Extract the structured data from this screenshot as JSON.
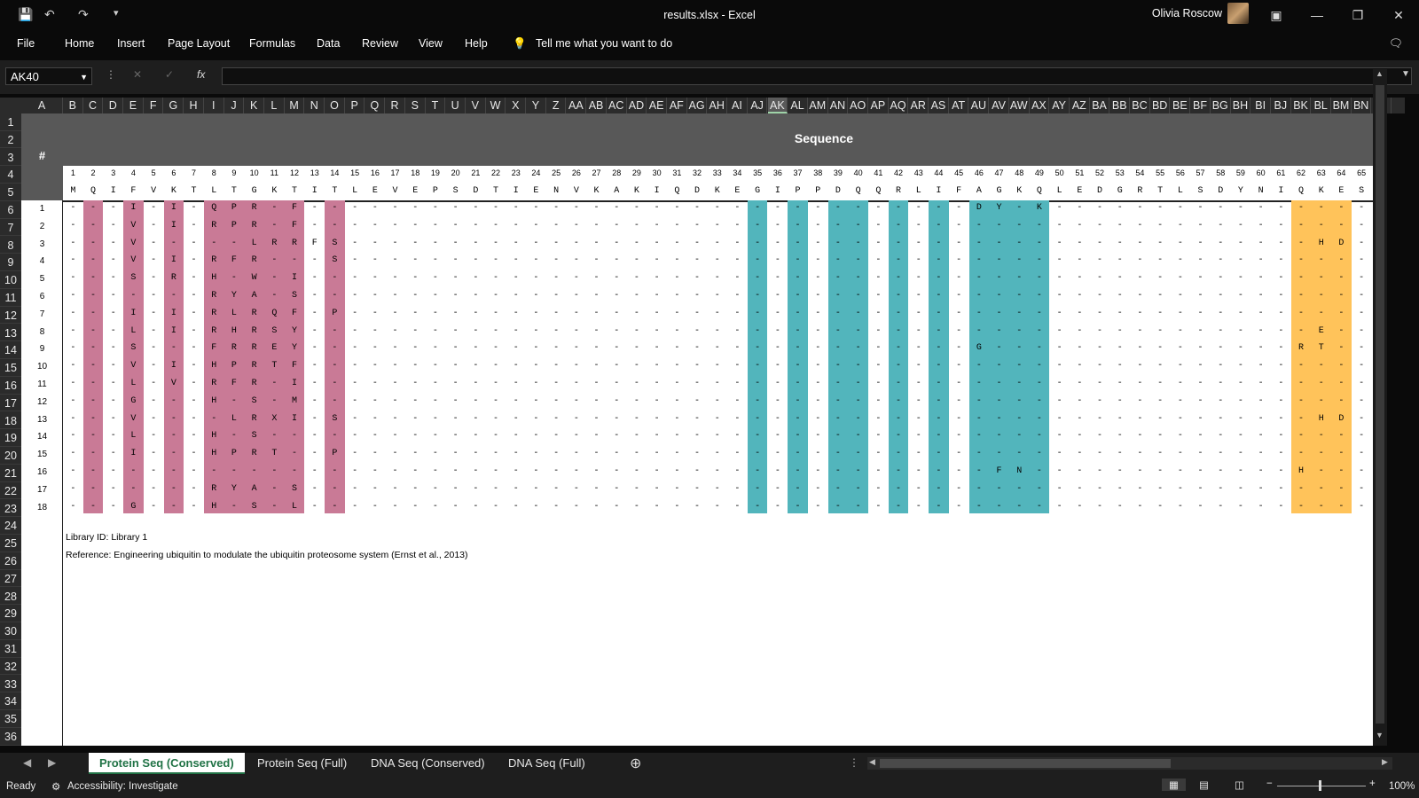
{
  "window": {
    "title": "results.xlsx  -  Excel",
    "user": "Olivia Roscow"
  },
  "ribbon": {
    "tabs": [
      "File",
      "Home",
      "Insert",
      "Page Layout",
      "Formulas",
      "Data",
      "Review",
      "View",
      "Help"
    ],
    "tell_me": "Tell me what you want to do"
  },
  "formula_bar": {
    "name_box": "AK40",
    "fx": "fx",
    "value": ""
  },
  "columns": [
    "A",
    "B",
    "C",
    "D",
    "E",
    "F",
    "G",
    "H",
    "I",
    "J",
    "K",
    "L",
    "M",
    "N",
    "O",
    "P",
    "Q",
    "R",
    "S",
    "T",
    "U",
    "V",
    "W",
    "X",
    "Y",
    "Z",
    "AA",
    "AB",
    "AC",
    "AD",
    "AE",
    "AF",
    "AG",
    "AH",
    "AI",
    "AJ",
    "AK",
    "AL",
    "AM",
    "AN",
    "AO",
    "AP",
    "AQ",
    "AR",
    "AS",
    "AT",
    "AU",
    "AV",
    "AW",
    "AX",
    "AY",
    "AZ",
    "BA",
    "BB",
    "BC",
    "BD",
    "BE",
    "BF",
    "BG",
    "BH",
    "BI",
    "BJ",
    "BK",
    "BL",
    "BM",
    "BN",
    "B"
  ],
  "selected_column": "AK",
  "rows": [
    "1",
    "2",
    "3",
    "4",
    "5",
    "6",
    "7",
    "8",
    "9",
    "10",
    "11",
    "12",
    "13",
    "14",
    "15",
    "16",
    "17",
    "18",
    "19",
    "20",
    "21",
    "22",
    "23",
    "24",
    "25",
    "26",
    "27",
    "28",
    "29",
    "30",
    "31",
    "32",
    "33",
    "34",
    "35",
    "36"
  ],
  "sheet": {
    "hash": "#",
    "header": "Sequence",
    "positions": [
      "1",
      "2",
      "3",
      "4",
      "5",
      "6",
      "7",
      "8",
      "9",
      "10",
      "11",
      "12",
      "13",
      "14",
      "15",
      "16",
      "17",
      "18",
      "19",
      "20",
      "21",
      "22",
      "23",
      "24",
      "25",
      "26",
      "27",
      "28",
      "29",
      "30",
      "31",
      "32",
      "33",
      "34",
      "35",
      "36",
      "37",
      "38",
      "39",
      "40",
      "41",
      "42",
      "43",
      "44",
      "45",
      "46",
      "47",
      "48",
      "49",
      "50",
      "51",
      "52",
      "53",
      "54",
      "55",
      "56",
      "57",
      "58",
      "59",
      "60",
      "61",
      "62",
      "63",
      "64",
      "65"
    ],
    "reference_seq": [
      "M",
      "Q",
      "I",
      "F",
      "V",
      "K",
      "T",
      "L",
      "T",
      "G",
      "K",
      "T",
      "I",
      "T",
      "L",
      "E",
      "V",
      "E",
      "P",
      "S",
      "D",
      "T",
      "I",
      "E",
      "N",
      "V",
      "K",
      "A",
      "K",
      "I",
      "Q",
      "D",
      "K",
      "E",
      "G",
      "I",
      "P",
      "P",
      "D",
      "Q",
      "Q",
      "R",
      "L",
      "I",
      "F",
      "A",
      "G",
      "K",
      "Q",
      "L",
      "E",
      "D",
      "G",
      "R",
      "T",
      "L",
      "S",
      "D",
      "Y",
      "N",
      "I",
      "Q",
      "K",
      "E",
      "S"
    ],
    "variants": [
      {
        "id": "1",
        "changes": {
          "4": "I",
          "6": "I",
          "8": "Q",
          "9": "P",
          "10": "R",
          "12": "F",
          "46": "D",
          "47": "Y",
          "49": "K"
        }
      },
      {
        "id": "2",
        "changes": {
          "4": "V",
          "6": "I",
          "8": "R",
          "9": "P",
          "10": "R",
          "12": "F"
        }
      },
      {
        "id": "3",
        "changes": {
          "4": "V",
          "10": "L",
          "11": "R",
          "12": "R",
          "13": "F",
          "14": "S",
          "63": "H",
          "64": "D"
        }
      },
      {
        "id": "4",
        "changes": {
          "4": "V",
          "6": "I",
          "8": "R",
          "9": "F",
          "10": "R",
          "14": "S"
        }
      },
      {
        "id": "5",
        "changes": {
          "4": "S",
          "6": "R",
          "8": "H",
          "10": "W",
          "12": "I"
        }
      },
      {
        "id": "6",
        "changes": {
          "8": "R",
          "9": "Y",
          "10": "A",
          "12": "S"
        }
      },
      {
        "id": "7",
        "changes": {
          "4": "I",
          "6": "I",
          "8": "R",
          "9": "L",
          "10": "R",
          "11": "Q",
          "12": "F",
          "14": "P"
        }
      },
      {
        "id": "8",
        "changes": {
          "4": "L",
          "6": "I",
          "8": "R",
          "9": "H",
          "10": "R",
          "11": "S",
          "12": "Y",
          "63": "E"
        }
      },
      {
        "id": "9",
        "changes": {
          "4": "S",
          "8": "F",
          "9": "R",
          "10": "R",
          "11": "E",
          "12": "Y",
          "46": "G",
          "62": "R",
          "63": "T"
        }
      },
      {
        "id": "10",
        "changes": {
          "4": "V",
          "6": "I",
          "8": "H",
          "9": "P",
          "10": "R",
          "11": "T",
          "12": "F"
        }
      },
      {
        "id": "11",
        "changes": {
          "4": "L",
          "6": "V",
          "8": "R",
          "9": "F",
          "10": "R",
          "12": "I"
        }
      },
      {
        "id": "12",
        "changes": {
          "4": "G",
          "8": "H",
          "10": "S",
          "12": "M"
        }
      },
      {
        "id": "13",
        "changes": {
          "4": "V",
          "9": "L",
          "10": "R",
          "11": "X",
          "12": "I",
          "14": "S",
          "63": "H",
          "64": "D"
        }
      },
      {
        "id": "14",
        "changes": {
          "4": "L",
          "8": "H",
          "10": "S"
        }
      },
      {
        "id": "15",
        "changes": {
          "4": "I",
          "8": "H",
          "9": "P",
          "10": "R",
          "11": "T",
          "14": "P"
        }
      },
      {
        "id": "16",
        "changes": {
          "47": "F",
          "48": "N",
          "62": "H"
        }
      },
      {
        "id": "17",
        "changes": {
          "8": "R",
          "9": "Y",
          "10": "A",
          "12": "S"
        }
      },
      {
        "id": "18",
        "changes": {
          "4": "G",
          "8": "H",
          "10": "S",
          "12": "L"
        }
      }
    ],
    "notes": [
      "Library ID: Library 1",
      "Reference: Engineering ubiquitin to modulate the ubiquitin proteosome system (Ernst et al., 2013)"
    ],
    "colors": {
      "pink": "#c97a96",
      "teal": "#52b5bc",
      "orange": "#ffc35a",
      "header_gray": "#585858"
    }
  },
  "sheet_tabs": [
    "Protein Seq (Conserved)",
    "Protein Seq (Full)",
    "DNA Seq (Conserved)",
    "DNA Seq (Full)"
  ],
  "status": {
    "ready": "Ready",
    "accessibility": "Accessibility: Investigate",
    "zoom": "100%"
  }
}
